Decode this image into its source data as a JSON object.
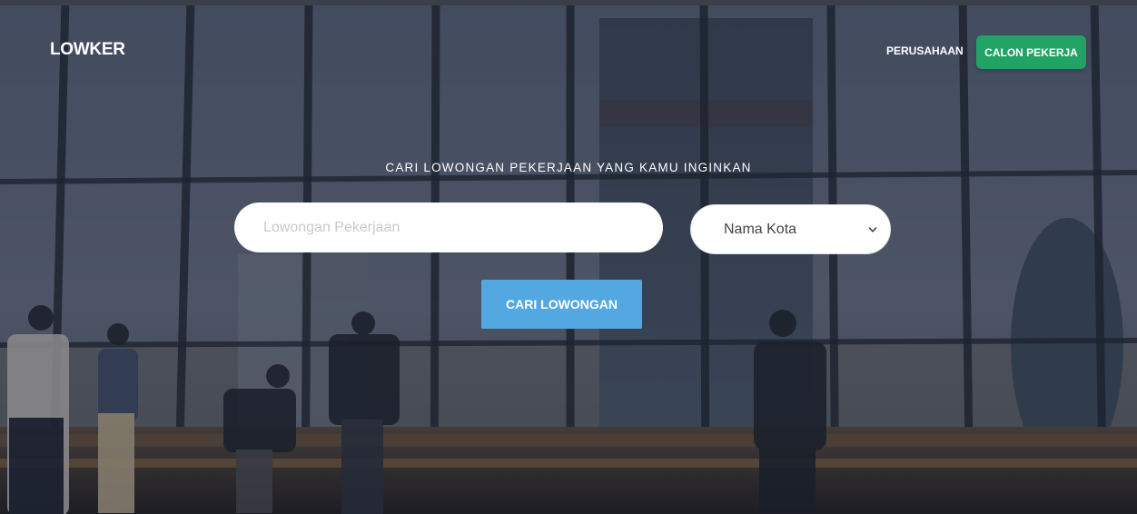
{
  "header": {
    "brand": "LOWKER",
    "nav": {
      "company_link": "PERUSAHAAN",
      "candidate_button": "CALON PEKERJA"
    }
  },
  "hero": {
    "headline": "CARI LOWONGAN PEKERJAAN YANG KAMU INGINKAN",
    "search": {
      "job_placeholder": "Lowongan Pekerjaan",
      "job_value": "",
      "city_selected": "Nama Kota",
      "submit_label": "CARI LOWONGAN"
    }
  },
  "colors": {
    "accent_green": "#21a366",
    "accent_blue": "#53a8e2",
    "text_white": "#ffffff"
  },
  "icons": {
    "select_arrow": "chevron-down-icon"
  }
}
